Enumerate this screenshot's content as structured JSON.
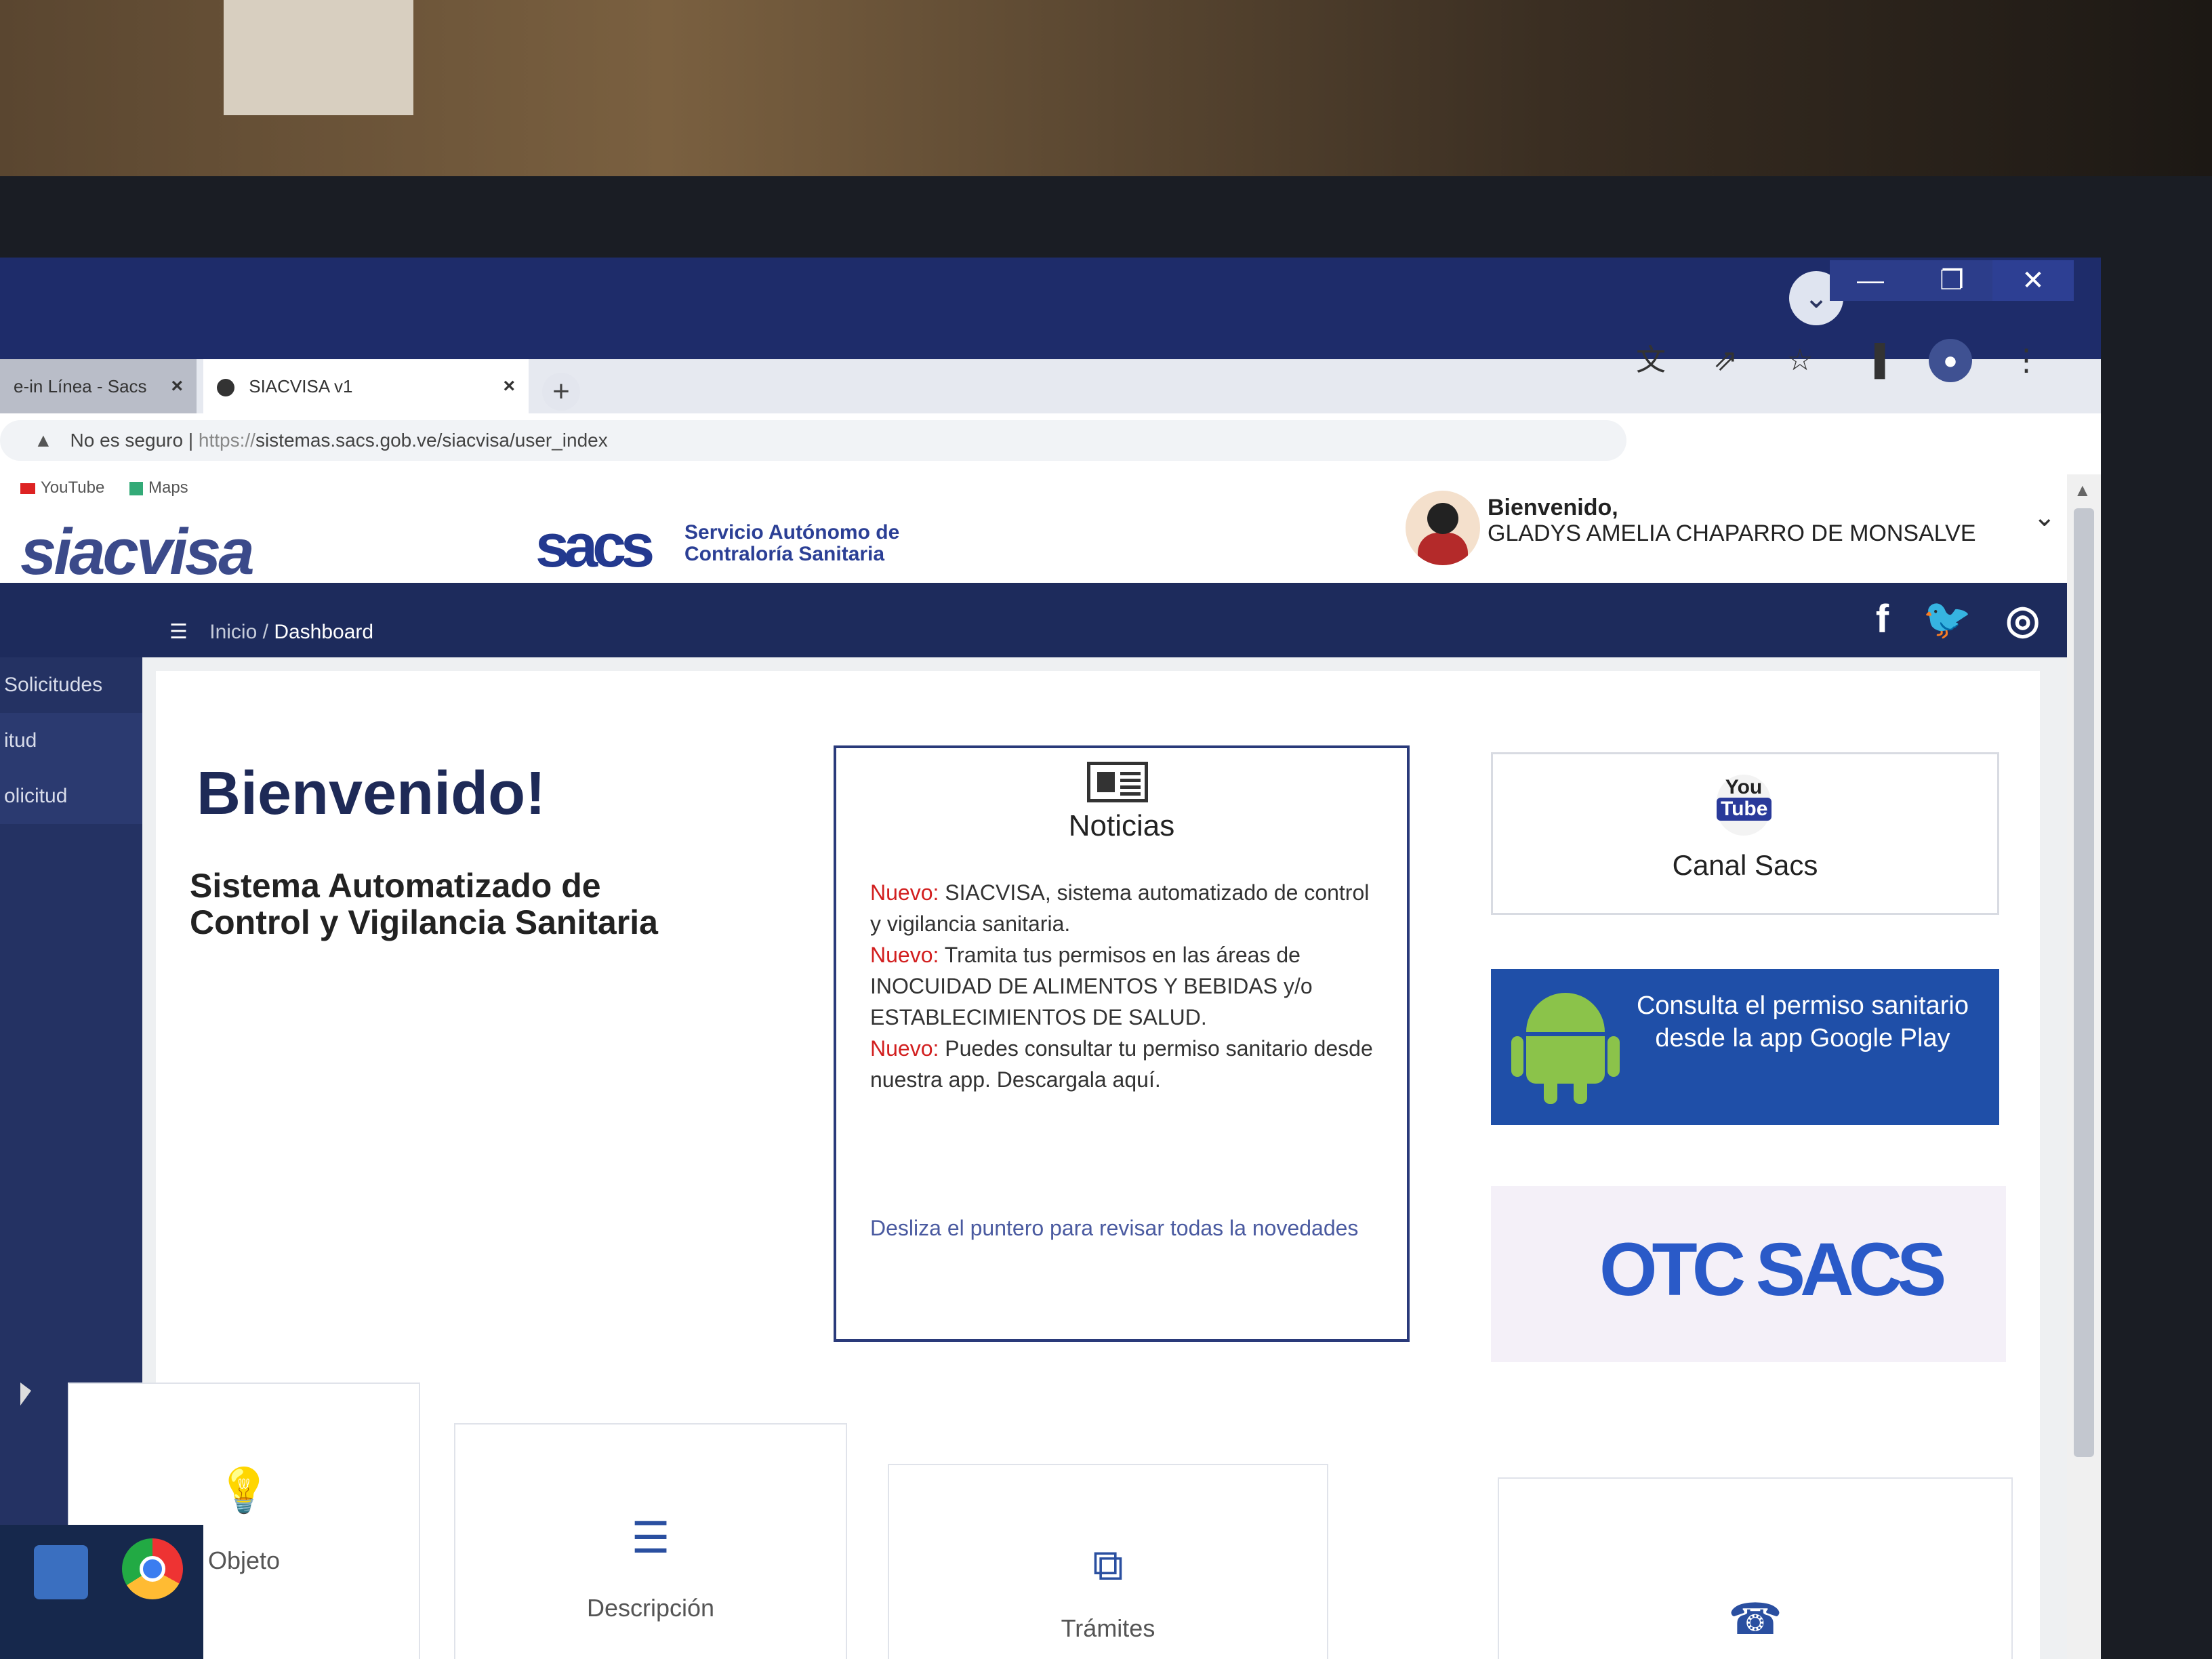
{
  "browser": {
    "tabs": [
      {
        "label": "e-in Línea - Sacs",
        "active": false
      },
      {
        "label": "SIACVISA v1",
        "active": true
      }
    ],
    "new_tab_symbol": "+",
    "address": {
      "security_label": "No es seguro",
      "url_scheme": "https://",
      "url_rest": "sistemas.sacs.gob.ve/siacvisa/user_index"
    },
    "bookmarks": [
      {
        "label": "YouTube",
        "icon": "youtube-icon"
      },
      {
        "label": "Maps",
        "icon": "maps-icon"
      }
    ],
    "toolbar_icons": [
      "translate-icon",
      "share-icon",
      "star-icon",
      "sidepanel-icon",
      "profile-icon",
      "kebab-menu-icon"
    ],
    "window_controls": {
      "minimize": "—",
      "maximize": "❐",
      "close": "✕"
    },
    "tab_search_symbol": "⌄"
  },
  "header": {
    "logo_siac": "siacvisa",
    "logo_sacs": "sacs",
    "sacs_sub_line1": "Servicio Autónomo de",
    "sacs_sub_line2": "Contraloría Sanitaria",
    "welcome_label": "Bienvenido,",
    "user_name": "GLADYS AMELIA CHAPARRO DE MONSALVE",
    "chevron": "⌄"
  },
  "navbar": {
    "social": {
      "facebook": "f",
      "twitter": "🐦",
      "instagram": "◎"
    },
    "menu_symbol": "☰",
    "breadcrumb_home": "Inicio",
    "breadcrumb_sep": "/",
    "breadcrumb_current": "Dashboard"
  },
  "sidebar": {
    "items": [
      "Solicitudes",
      "itud",
      "olicitud"
    ]
  },
  "main": {
    "heading": "Bienvenido!",
    "subtitle": "Sistema Automatizado de Control y Vigilancia Sanitaria"
  },
  "news": {
    "title": "Noticias",
    "items": [
      {
        "tag": "Nuevo:",
        "text": " SIACVISA, sistema automatizado de control y vigilancia sanitaria."
      },
      {
        "tag": "Nuevo:",
        "text": " Tramita tus permisos en las áreas de INOCUIDAD DE ALIMENTOS Y BEBIDAS y/o ESTABLECIMIENTOS DE SALUD."
      },
      {
        "tag": "Nuevo:",
        "text": " Puedes consultar tu permiso sanitario desde nuestra app. Descargala aquí."
      }
    ],
    "footer": "Desliza el puntero para revisar todas la novedades"
  },
  "youtube": {
    "you": "You",
    "tube": "Tube",
    "label": "Canal Sacs"
  },
  "play": {
    "text": "Consulta el permiso sanitario desde la app Google Play"
  },
  "otc": {
    "text": "OTC SACS"
  },
  "cards": [
    {
      "label": "Objeto",
      "icon": "lightbulb-icon",
      "glyph": "💡"
    },
    {
      "label": "Descripción",
      "icon": "list-icon",
      "glyph": "☰"
    },
    {
      "label": "Trámites",
      "icon": "documents-icon",
      "glyph": "⧉"
    },
    {
      "label": "",
      "icon": "phone-icon",
      "glyph": "☎"
    }
  ]
}
